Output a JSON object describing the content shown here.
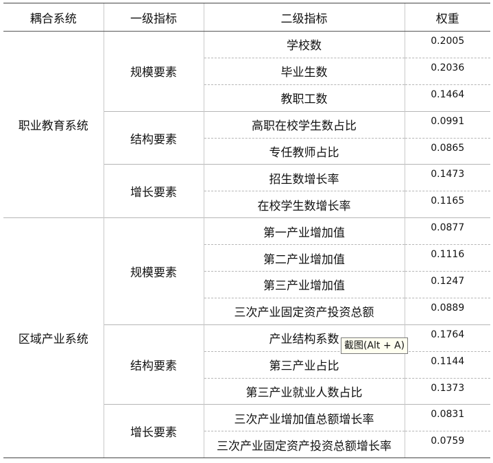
{
  "table": {
    "headers": [
      "耦合系统",
      "一级指标",
      "二级指标",
      "权重"
    ],
    "systems": [
      {
        "name": "职业教育系统",
        "groups": [
          {
            "name": "规模要素",
            "items": [
              {
                "indicator": "学校数",
                "weight": "0.2005"
              },
              {
                "indicator": "毕业生数",
                "weight": "0.2036"
              },
              {
                "indicator": "教职工数",
                "weight": "0.1464"
              }
            ]
          },
          {
            "name": "结构要素",
            "items": [
              {
                "indicator": "高职在校学生数占比",
                "weight": "0.0991"
              },
              {
                "indicator": "专任教师占比",
                "weight": "0.0865"
              }
            ]
          },
          {
            "name": "增长要素",
            "items": [
              {
                "indicator": "招生数增长率",
                "weight": "0.1473"
              },
              {
                "indicator": "在校学生数增长率",
                "weight": "0.1165"
              }
            ]
          }
        ]
      },
      {
        "name": "区域产业系统",
        "groups": [
          {
            "name": "规模要素",
            "items": [
              {
                "indicator": "第一产业增加值",
                "weight": "0.0877"
              },
              {
                "indicator": "第二产业增加值",
                "weight": "0.1116"
              },
              {
                "indicator": "第三产业增加值",
                "weight": "0.1247"
              },
              {
                "indicator": "三次产业固定资产投资总额",
                "weight": "0.0889"
              }
            ]
          },
          {
            "name": "结构要素",
            "items": [
              {
                "indicator": "产业结构系数",
                "weight": "0.1764"
              },
              {
                "indicator": "第三产业占比",
                "weight": "0.1144"
              },
              {
                "indicator": "第三产业就业人数占比",
                "weight": "0.1373"
              }
            ]
          },
          {
            "name": "增长要素",
            "items": [
              {
                "indicator": "三次产业增加值总额增长率",
                "weight": "0.0831"
              },
              {
                "indicator": "三次产业固定资产投资总额增长率",
                "weight": "0.0759"
              }
            ]
          }
        ]
      }
    ]
  },
  "tooltip": {
    "text": "截图(Alt + A)"
  }
}
